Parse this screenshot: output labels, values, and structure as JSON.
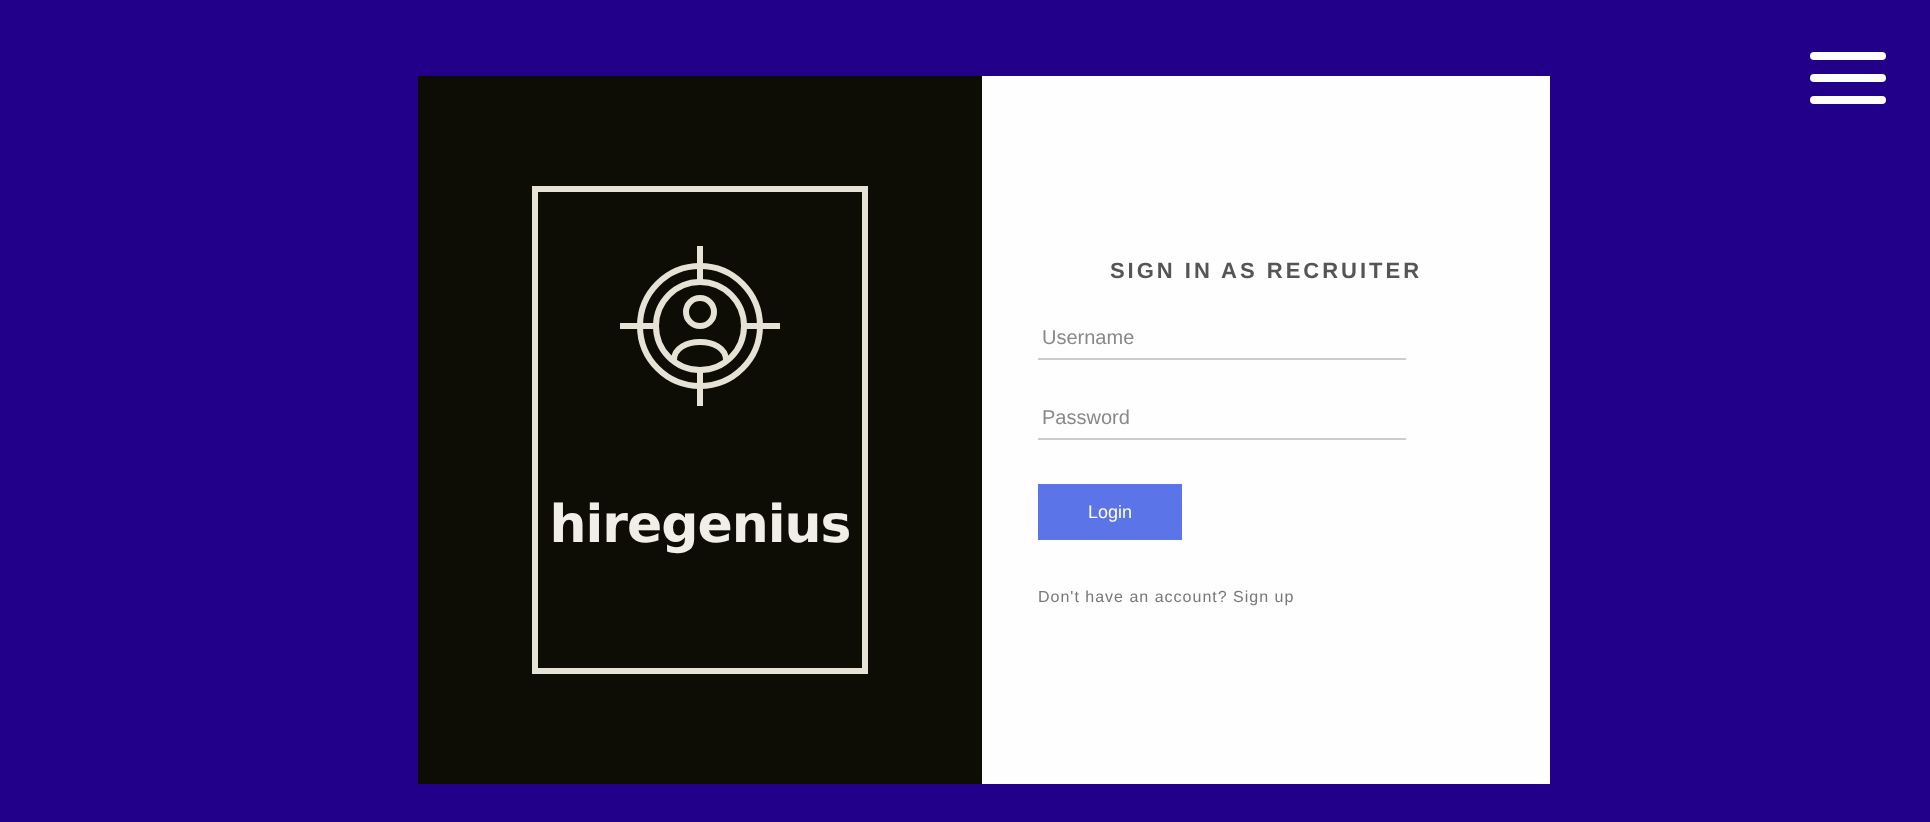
{
  "brand": {
    "name": "hiregenius"
  },
  "form": {
    "title": "SIGN IN AS RECRUITER",
    "fields": [
      {
        "placeholder": "Username"
      },
      {
        "placeholder": "Password"
      }
    ],
    "button": "Login",
    "signup": "Don't have an account? Sign up"
  }
}
